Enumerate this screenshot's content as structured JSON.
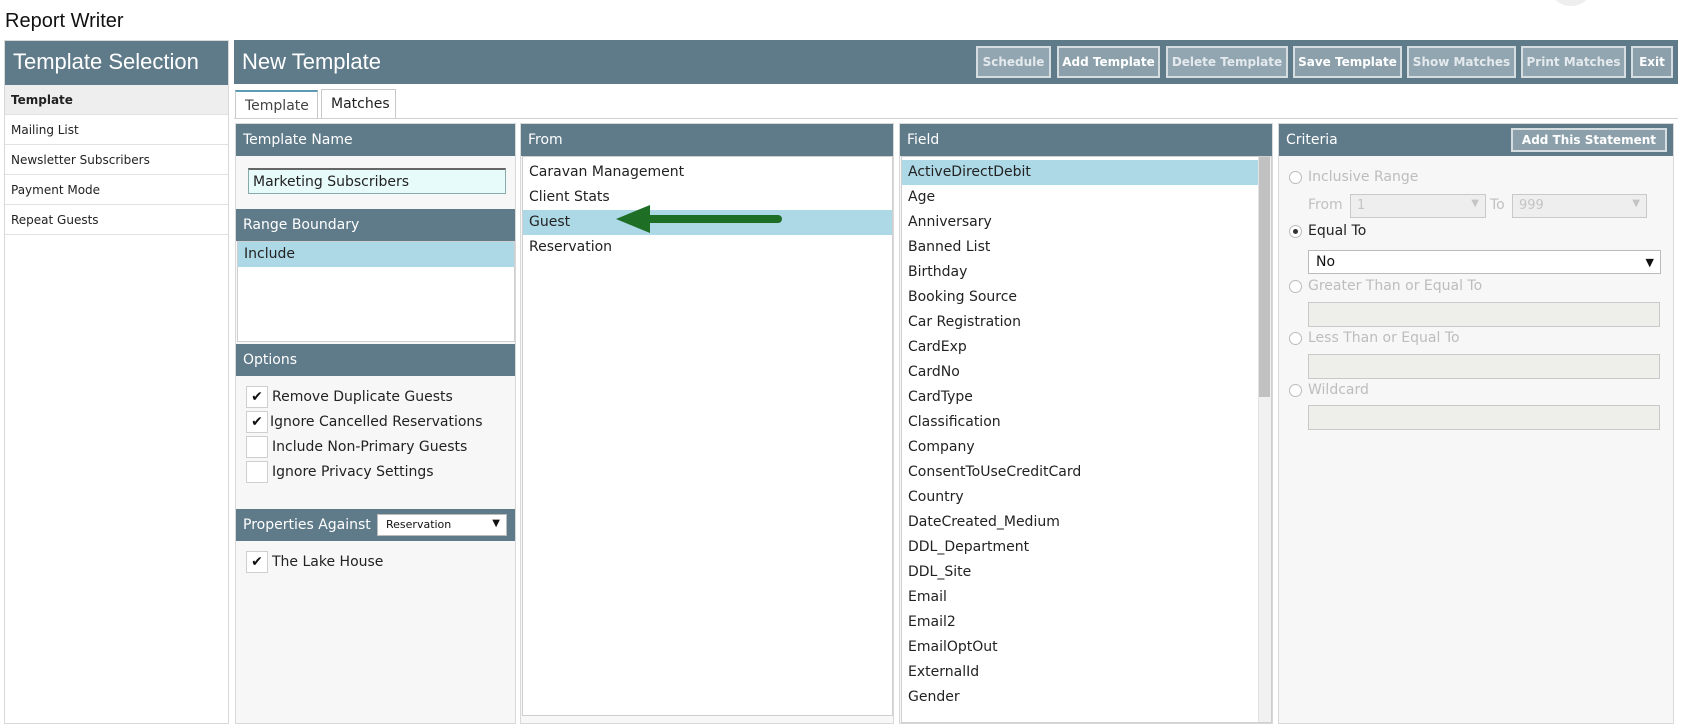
{
  "app": {
    "title": "Report Writer"
  },
  "sidebar": {
    "title": "Template Selection",
    "items": [
      {
        "label": "Template",
        "active": true
      },
      {
        "label": "Mailing List",
        "active": false
      },
      {
        "label": "Newsletter Subscribers",
        "active": false
      },
      {
        "label": "Payment Mode",
        "active": false
      },
      {
        "label": "Repeat Guests",
        "active": false
      }
    ]
  },
  "header": {
    "title": "New Template",
    "buttons": [
      {
        "label": "Schedule",
        "enabled": false
      },
      {
        "label": "Add Template",
        "enabled": true
      },
      {
        "label": "Delete Template",
        "enabled": false
      },
      {
        "label": "Save Template",
        "enabled": true
      },
      {
        "label": "Show Matches",
        "enabled": false
      },
      {
        "label": "Print Matches",
        "enabled": false
      },
      {
        "label": "Exit",
        "enabled": true
      }
    ]
  },
  "tabs": [
    {
      "label": "Template",
      "active": true
    },
    {
      "label": "Matches",
      "active": false
    }
  ],
  "template_name": {
    "heading": "Template Name",
    "value": "Marketing Subscribers"
  },
  "range_boundary": {
    "heading": "Range Boundary",
    "items": [
      {
        "label": "Include",
        "selected": true
      }
    ]
  },
  "options": {
    "heading": "Options",
    "items": [
      {
        "label": "Remove Duplicate Guests",
        "checked": true
      },
      {
        "label": "Ignore Cancelled Reservations",
        "checked": true
      },
      {
        "label": "Include Non-Primary Guests",
        "checked": false
      },
      {
        "label": "Ignore Privacy Settings",
        "checked": false
      }
    ]
  },
  "properties": {
    "heading": "Properties Against",
    "selected": "Reservation",
    "items": [
      {
        "label": "The Lake House",
        "checked": true
      }
    ]
  },
  "from": {
    "heading": "From",
    "items": [
      {
        "label": "Caravan Management",
        "selected": false
      },
      {
        "label": "Client Stats",
        "selected": false
      },
      {
        "label": "Guest",
        "selected": true
      },
      {
        "label": "Reservation",
        "selected": false
      }
    ]
  },
  "field": {
    "heading": "Field",
    "items": [
      {
        "label": "ActiveDirectDebit",
        "selected": true
      },
      {
        "label": "Age"
      },
      {
        "label": "Anniversary"
      },
      {
        "label": "Banned List"
      },
      {
        "label": "Birthday"
      },
      {
        "label": "Booking Source"
      },
      {
        "label": "Car Registration"
      },
      {
        "label": "CardExp"
      },
      {
        "label": "CardNo"
      },
      {
        "label": "CardType"
      },
      {
        "label": "Classification"
      },
      {
        "label": "Company"
      },
      {
        "label": "ConsentToUseCreditCard"
      },
      {
        "label": "Country"
      },
      {
        "label": "DateCreated_Medium"
      },
      {
        "label": "DDL_Department"
      },
      {
        "label": "DDL_Site"
      },
      {
        "label": "Email"
      },
      {
        "label": "Email2"
      },
      {
        "label": "EmailOptOut"
      },
      {
        "label": "ExternalId"
      },
      {
        "label": "Gender"
      }
    ]
  },
  "criteria": {
    "heading": "Criteria",
    "add_button": "Add This Statement",
    "inclusive_range": {
      "label": "Inclusive Range",
      "from_label": "From",
      "from_value": "1",
      "to_label": "To",
      "to_value": "999"
    },
    "equal_to": {
      "label": "Equal To",
      "value": "No",
      "selected": true
    },
    "greater_than": {
      "label": "Greater Than or Equal To"
    },
    "less_than": {
      "label": "Less Than or Equal To"
    },
    "wildcard": {
      "label": "Wildcard"
    }
  },
  "colors": {
    "header": "#5f7b8a",
    "selection": "#add8e6",
    "arrow": "#1e6e26"
  }
}
